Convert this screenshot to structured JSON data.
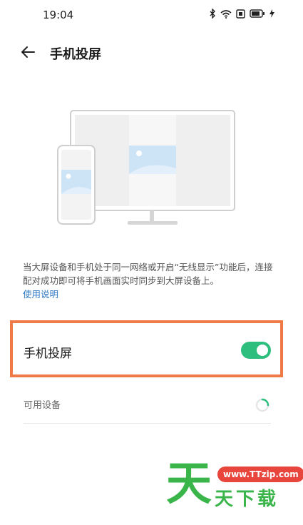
{
  "status": {
    "time": "19:04"
  },
  "header": {
    "title": "手机投屏"
  },
  "description": {
    "text": "当大屏设备和手机处于同一网络或开启“无线显示”功能后，连接配对成功即可将手机画面实时同步到大屏设备上。",
    "help_link": "使用说明"
  },
  "screen_cast": {
    "label": "手机投屏",
    "enabled": true
  },
  "available_devices": {
    "label": "可用设备"
  },
  "watermark": {
    "big": "天",
    "url": "www.TTzip.com",
    "small": "天下载"
  },
  "colors": {
    "accent": "#2dbd7d",
    "link": "#2b79c2",
    "highlight": "#f07a47"
  }
}
